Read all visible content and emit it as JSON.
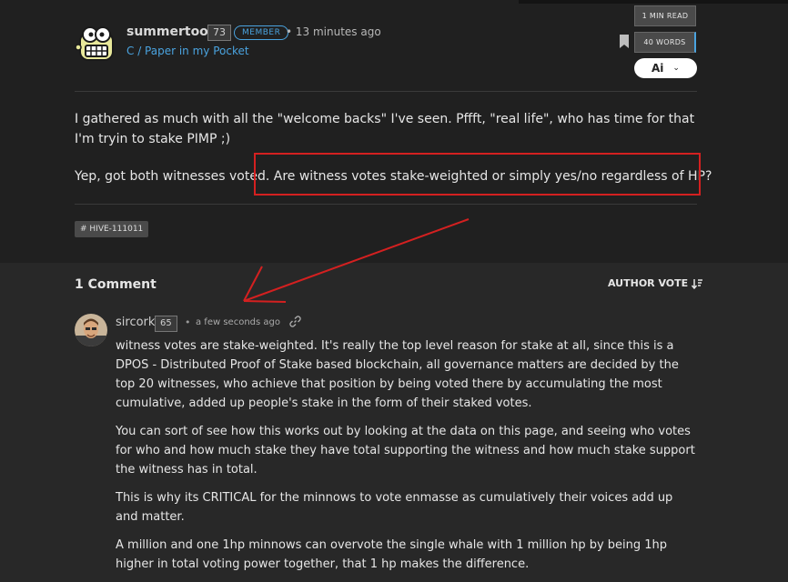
{
  "post": {
    "author": {
      "name": "summertooth",
      "reputation": "73",
      "badge": "MEMBER",
      "time": "• 13 minutes ago",
      "community": "C / Paper in my Pocket"
    },
    "stats": {
      "read_time": "1 MIN READ",
      "word_count": "40 WORDS"
    },
    "language": {
      "label": "Ai",
      "chevron": "⌄"
    },
    "paragraphs": [
      "I gathered as much with all the \"welcome backs\" I've seen. Pffft, \"real life\", who has time for that I'm tryin to stake PIMP ;)",
      "Yep, got both witnesses voted. Are witness votes stake-weighted or simply yes/no regardless of HP?"
    ],
    "tags": [
      "# HIVE-111011"
    ]
  },
  "comments": {
    "title": "1 Comment",
    "sort_label": "AUTHOR VOTE",
    "items": [
      {
        "author": "sircork",
        "reputation": "65",
        "dot": "•",
        "time": "a few seconds ago",
        "paragraphs": [
          "witness votes are stake-weighted. It's really the top level reason for stake at all, since this is a DPOS - Distributed Proof of Stake based blockchain, all governance matters are decided by the top 20 witnesses, who achieve that position by being voted there by accumulating the most cumulative, added up people's stake in the form of their staked votes.",
          "You can sort of see how this works out by looking at the data on this page, and seeing who votes for who and how much stake they have total supporting the witness and how much stake support the witness has in total.",
          "This is why its CRITICAL for the minnows to vote enmasse as cumulatively their voices add up and matter.",
          "A million and one 1hp minnows can overvote the single whale with 1 million hp by being 1hp higher in total voting power together, that 1 hp makes the difference."
        ]
      }
    ]
  },
  "icons": {
    "bookmark": "bookmark-icon",
    "link": "link-icon",
    "sort": "sort-icon"
  },
  "colors": {
    "accent": "#4aa3df",
    "annotation": "#d42020",
    "background": "#202020",
    "comment_background": "#282828"
  }
}
